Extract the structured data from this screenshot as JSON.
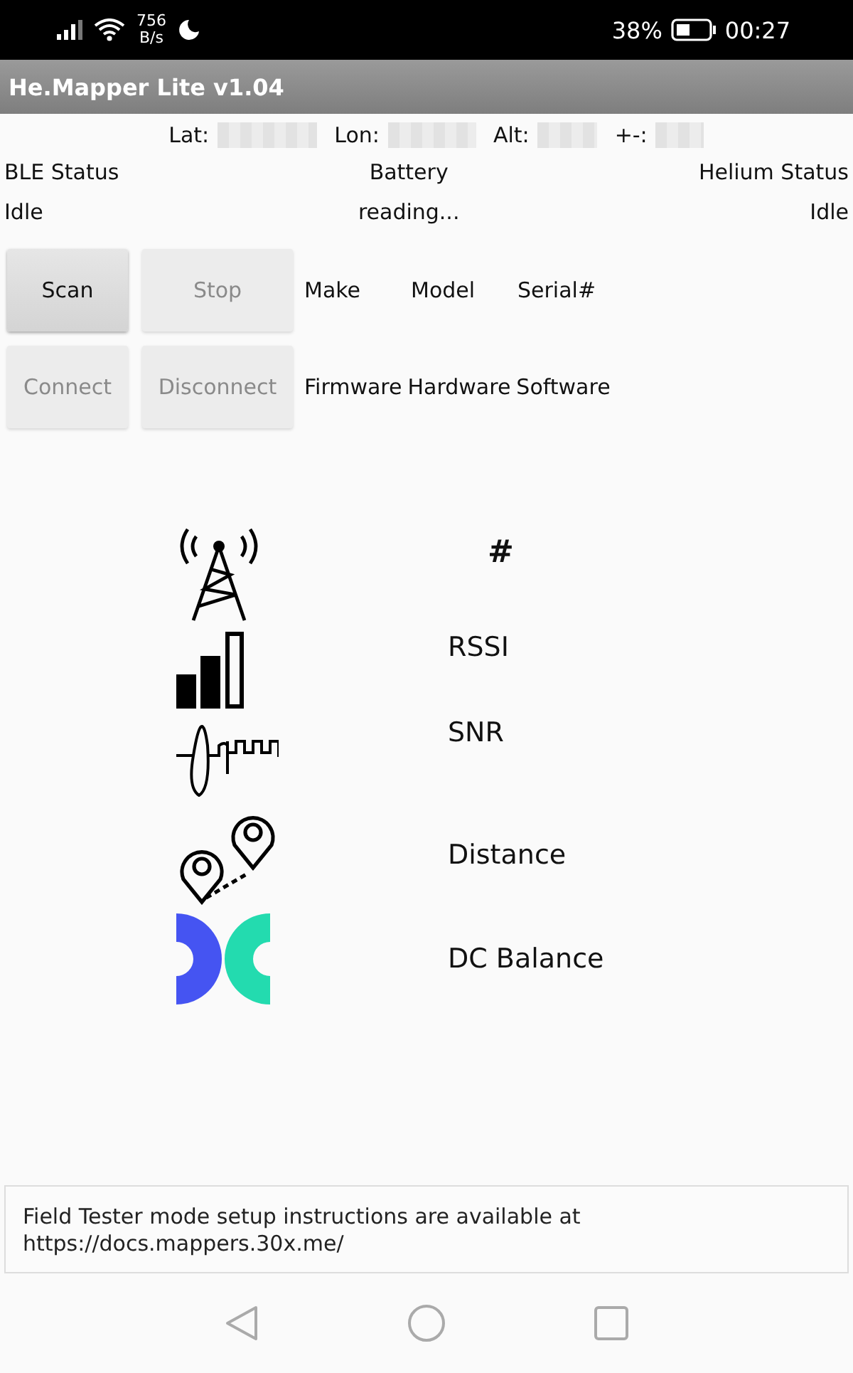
{
  "status_bar": {
    "net_speed": "756",
    "net_unit": "B/s",
    "battery": "38%",
    "time": "00:27"
  },
  "app_bar": {
    "title": "He.Mapper Lite v1.04"
  },
  "location": [
    {
      "label": "Lat:"
    },
    {
      "label": "Lon:"
    },
    {
      "label": "Alt:"
    },
    {
      "label": "+-:"
    }
  ],
  "status": [
    {
      "label": "BLE Status",
      "value": "Idle"
    },
    {
      "label": "Battery",
      "value": "reading..."
    },
    {
      "label": "Helium Status",
      "value": "Idle"
    }
  ],
  "button_rows": [
    {
      "buttons": [
        {
          "label": "Scan",
          "disabled": false
        },
        {
          "label": "Stop",
          "disabled": true
        }
      ],
      "fields": [
        "Make",
        "Model",
        "Serial#"
      ]
    },
    {
      "buttons": [
        {
          "label": "Connect",
          "disabled": true
        },
        {
          "label": "Disconnect",
          "disabled": true
        }
      ],
      "fields": [
        "Firmware",
        "Hardware",
        "Software"
      ]
    }
  ],
  "metrics": [
    {
      "kind": "tower",
      "label": "#"
    },
    {
      "kind": "bars",
      "label": "RSSI"
    },
    {
      "kind": "wave",
      "label": "SNR"
    },
    {
      "kind": "pins",
      "label": "Distance"
    },
    {
      "kind": "dc",
      "label": "DC Balance"
    }
  ],
  "notice": {
    "text": "Field Tester mode setup instructions are available at https://docs.mappers.30x.me/"
  }
}
